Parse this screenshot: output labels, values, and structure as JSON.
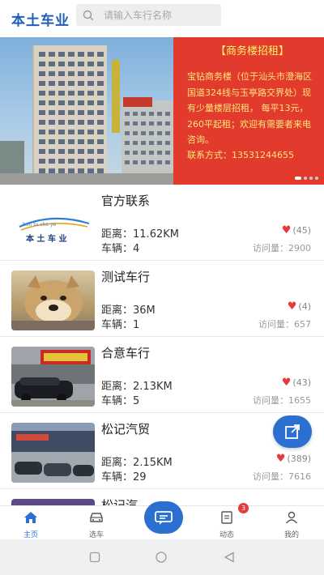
{
  "header": {
    "logo": "本土车业",
    "search_placeholder": "请输入车行名称"
  },
  "banner": {
    "title": "【商务楼招租】",
    "body": "宝钻商务楼（位于汕头市澄海区国道324线与玉亭路交界处）现有少量楼层招租，   每平13元，   260平起租；欢迎有需要者来电咨询。",
    "contact": "联系方式：13531244655",
    "building_sign_left": "",
    "page_count": 4,
    "active_page": 1
  },
  "dealers": [
    {
      "name": "官方联系",
      "distance_label": "距离：",
      "distance": "11.62KM",
      "cars_label": "车辆：",
      "cars": "4",
      "likes": "(45)",
      "views_label": "访问量：",
      "views": "2900",
      "thumb": "logo",
      "logo_text": "本 土 车 业",
      "logo_pinyin": "ben tu che ye"
    },
    {
      "name": "测试车行",
      "distance_label": "距离：",
      "distance": "36M",
      "cars_label": "车辆：",
      "cars": "1",
      "likes": "(4)",
      "views_label": "访问量：",
      "views": "657",
      "thumb": "dog"
    },
    {
      "name": "合意车行",
      "distance_label": "距离：",
      "distance": "2.13KM",
      "cars_label": "车辆：",
      "cars": "5",
      "likes": "(43)",
      "views_label": "访问量：",
      "views": "1655",
      "thumb": "store"
    },
    {
      "name": "松记汽贸",
      "distance_label": "距离：",
      "distance": "2.15KM",
      "cars_label": "车辆：",
      "cars": "29",
      "likes": "(389)",
      "views_label": "访问量：",
      "views": "7616",
      "thumb": "mall"
    },
    {
      "name": "松记汽",
      "thumb": "partial"
    }
  ],
  "tabs": {
    "home": "主页",
    "select_car": "选车",
    "news": "动态",
    "mine": "我的",
    "news_badge": "3"
  },
  "colors": {
    "brand": "#1f5fb8",
    "accent": "#2b6fd1",
    "banner_red": "#e23a2d",
    "heart": "#e53b3b"
  }
}
